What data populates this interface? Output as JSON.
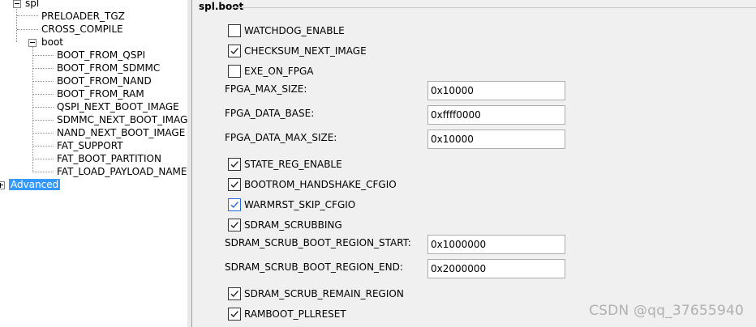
{
  "tree": {
    "spl": "spl",
    "preloader_tgz": "PRELOADER_TGZ",
    "cross_compile": "CROSS_COMPILE",
    "boot": "boot",
    "boot_children": [
      "BOOT_FROM_QSPI",
      "BOOT_FROM_SDMMC",
      "BOOT_FROM_NAND",
      "BOOT_FROM_RAM",
      "QSPI_NEXT_BOOT_IMAGE",
      "SDMMC_NEXT_BOOT_IMAGE",
      "NAND_NEXT_BOOT_IMAGE",
      "FAT_SUPPORT",
      "FAT_BOOT_PARTITION",
      "FAT_LOAD_PAYLOAD_NAME"
    ],
    "advanced": "Advanced"
  },
  "panel": {
    "title": "spl.boot",
    "watchdog_enable": {
      "label": "WATCHDOG_ENABLE",
      "checked": false
    },
    "checksum_next_image": {
      "label": "CHECKSUM_NEXT_IMAGE",
      "checked": true
    },
    "exe_on_fpga": {
      "label": "EXE_ON_FPGA",
      "checked": false
    },
    "fpga_max_size": {
      "label": "FPGA_MAX_SIZE:",
      "value": "0x10000"
    },
    "fpga_data_base": {
      "label": "FPGA_DATA_BASE:",
      "value": "0xffff0000"
    },
    "fpga_data_max_size": {
      "label": "FPGA_DATA_MAX_SIZE:",
      "value": "0x10000"
    },
    "state_reg_enable": {
      "label": "STATE_REG_ENABLE",
      "checked": true
    },
    "bootrom_handshake_cfgio": {
      "label": "BOOTROM_HANDSHAKE_CFGIO",
      "checked": true
    },
    "warmrst_skip_cfgio": {
      "label": "WARMRST_SKIP_CFGIO",
      "checked": true
    },
    "sdram_scrubbing": {
      "label": "SDRAM_SCRUBBING",
      "checked": true
    },
    "sdram_scrub_boot_region_start": {
      "label": "SDRAM_SCRUB_BOOT_REGION_START:",
      "value": "0x1000000"
    },
    "sdram_scrub_boot_region_end": {
      "label": "SDRAM_SCRUB_BOOT_REGION_END:",
      "value": "0x2000000"
    },
    "sdram_scrub_remain_region": {
      "label": "SDRAM_SCRUB_REMAIN_REGION",
      "checked": true
    },
    "ramboot_pllreset": {
      "label": "RAMBOOT_PLLRESET",
      "checked": true
    }
  },
  "watermark": "CSDN @qq_37655940",
  "colors": {
    "selection": "#3399ff",
    "checkbox_highlight": "#2a6ad6"
  }
}
